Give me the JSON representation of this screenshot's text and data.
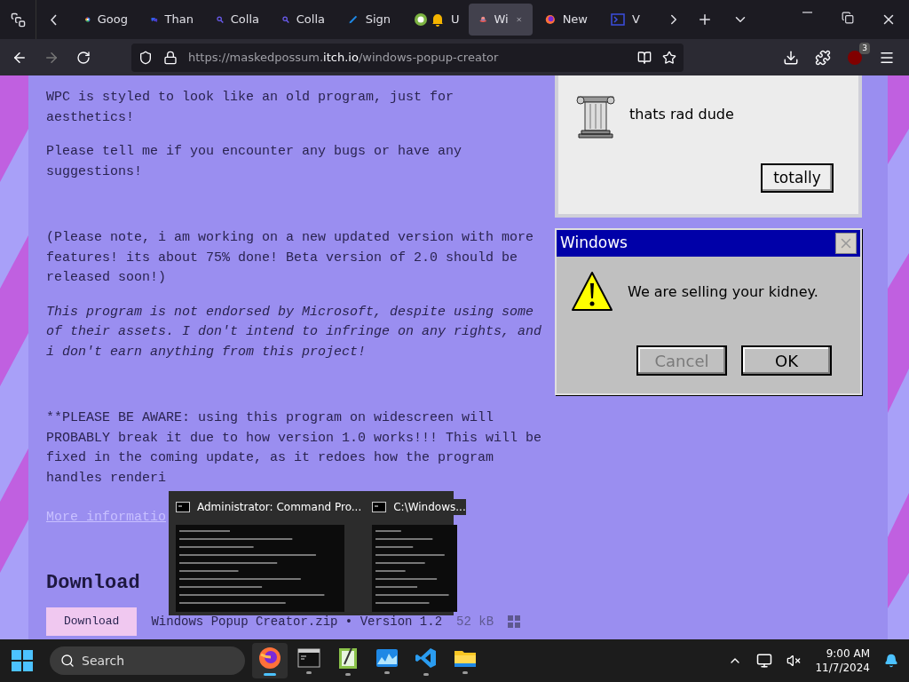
{
  "browser": {
    "tabs": [
      {
        "kind": "google",
        "label": "Goog",
        "selected": false
      },
      {
        "kind": "chat",
        "label": "Than",
        "selected": false
      },
      {
        "kind": "search",
        "label": "Colla",
        "selected": false
      },
      {
        "kind": "search",
        "label": "Colla",
        "selected": false
      },
      {
        "kind": "pen",
        "label": "Sign",
        "selected": false
      },
      {
        "kind": "bell",
        "label": "U",
        "selected": false
      },
      {
        "kind": "hat",
        "label": "Wi",
        "selected": true
      },
      {
        "kind": "firefox",
        "label": "New",
        "selected": false
      },
      {
        "kind": "code",
        "label": "V",
        "selected": false
      }
    ],
    "url": {
      "prefix": "https://maskedpossum.",
      "domain": "itch.io",
      "path": "/windows-popup-creator"
    },
    "extension_badge": "3"
  },
  "page": {
    "paragraphs": [
      {
        "text": "WPC is styled to look like an old program, just for aesthetics!",
        "italic": false,
        "gap_before": false
      },
      {
        "text": "Please tell me if you encounter any bugs or have any suggestions!",
        "italic": false,
        "gap_before": false
      },
      {
        "text": "(Please note, i am working on a new updated version with more features! its about 75% done! Beta version of 2.0 should be released soon!)",
        "italic": false,
        "gap_before": true
      },
      {
        "text": "This program is not endorsed by Microsoft, despite using some of their assets. I don't intend to infringe on any rights, and i don't earn anything from this project!",
        "italic": true,
        "gap_before": false
      },
      {
        "text": "**PLEASE BE AWARE: using this program on widescreen will PROBABLY break it due to how version 1.0 works!!! This will be fixed in the coming update, as it redoes how the program handles renderi",
        "italic": false,
        "gap_before": true
      }
    ],
    "link": "More informatio",
    "heading": "Download",
    "download_button": "Download",
    "file": "Windows Popup Creator.zip • Version 1.2",
    "size": "52 kB"
  },
  "popups": [
    {
      "kind": "column",
      "message": "thats rad dude",
      "buttons": [
        {
          "label": "totally",
          "disabled": false
        }
      ]
    },
    {
      "kind": "warning",
      "title": "Windows",
      "message": "We are selling your kidney.",
      "buttons": [
        {
          "label": "Cancel",
          "disabled": true
        },
        {
          "label": "OK",
          "disabled": false
        }
      ]
    }
  ],
  "preview": {
    "windows": [
      {
        "title": "Administrator: Command Pro..."
      },
      {
        "title": "C:\\Windows..."
      }
    ]
  },
  "taskbar": {
    "search_placeholder": "Search",
    "apps": [
      {
        "kind": "firefox",
        "selected": true
      },
      {
        "kind": "terminal",
        "selected": false
      },
      {
        "kind": "notepad",
        "selected": false
      },
      {
        "kind": "photos",
        "selected": false
      },
      {
        "kind": "vscode",
        "selected": false
      },
      {
        "kind": "folder",
        "selected": false
      }
    ],
    "time": "9:00 AM",
    "date": "11/7/2024"
  }
}
